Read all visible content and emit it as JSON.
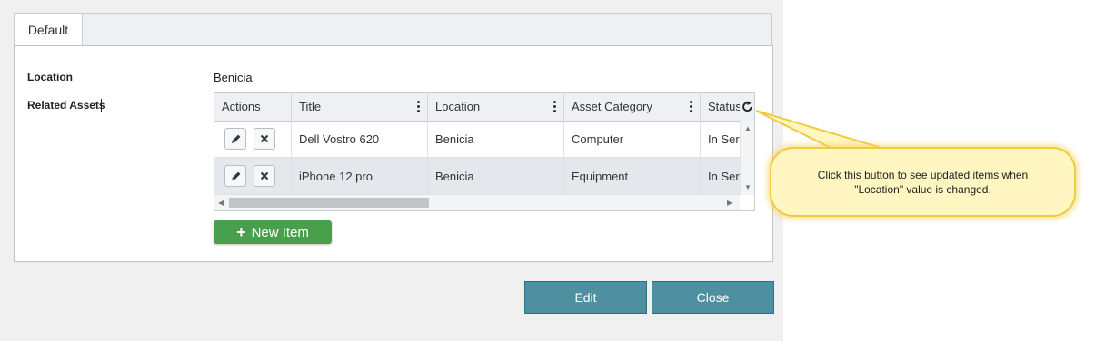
{
  "tabs": [
    {
      "label": "Default",
      "active": true
    }
  ],
  "form": {
    "location_label": "Location",
    "location_value": "Benicia",
    "related_assets_label": "Related Assets"
  },
  "grid": {
    "columns": [
      "Actions",
      "Title",
      "Location",
      "Asset Category",
      "Status"
    ],
    "rows": [
      {
        "title": "Dell Vostro 620",
        "location": "Benicia",
        "category": "Computer",
        "status": "In Ser"
      },
      {
        "title": "iPhone 12 pro",
        "location": "Benicia",
        "category": "Equipment",
        "status": "In Ser"
      }
    ],
    "row_icons": [
      "pencil-icon",
      "close-icon"
    ],
    "header_menu_icon": "kebab-icon",
    "refresh_icon": "refresh-icon"
  },
  "new_item": {
    "icon": "plus-icon",
    "label": "New Item"
  },
  "footer": {
    "edit_label": "Edit",
    "close_label": "Close"
  },
  "callout": {
    "text": "Click this button to see updated items when \"Location\" value is changed."
  },
  "colors": {
    "primary_button": "#4e8fa0",
    "add_button": "#48a04c",
    "callout_fill": "#fff6c2",
    "callout_border": "#f0ca40"
  }
}
